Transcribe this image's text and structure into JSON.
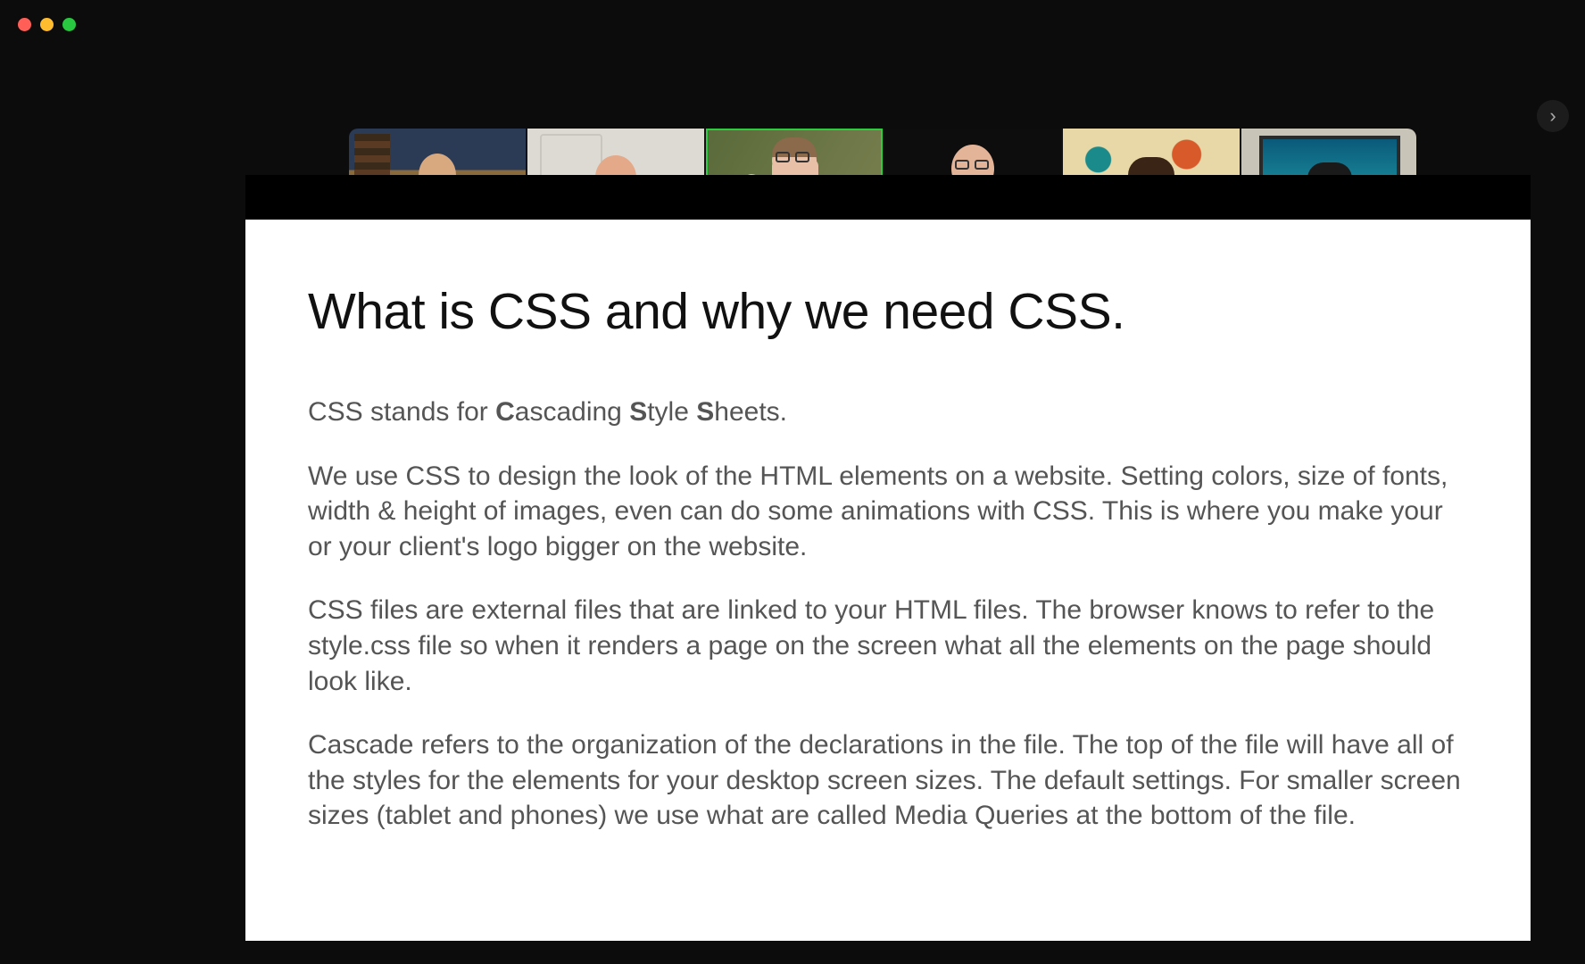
{
  "window": {
    "traffic_lights": [
      "close",
      "minimize",
      "maximize"
    ]
  },
  "participants": {
    "count": 6,
    "active_index": 2,
    "items": [
      {
        "name": "participant-1"
      },
      {
        "name": "participant-2"
      },
      {
        "name": "participant-3"
      },
      {
        "name": "participant-4"
      },
      {
        "name": "participant-5"
      },
      {
        "name": "participant-6"
      }
    ],
    "next_label": "›"
  },
  "slide": {
    "title": "What is CSS and why we need CSS.",
    "paragraphs": [
      {
        "pre": "CSS stands for ",
        "b1": "C",
        "mid1": "ascading ",
        "b2": "S",
        "mid2": "tyle ",
        "b3": "S",
        "post": "heets."
      },
      {
        "text": "We use CSS to design the look of the HTML elements on a website. Setting colors, size of fonts, width & height of images, even can do some animations with CSS. This is where you make your or your client's logo bigger on the website."
      },
      {
        "text": "CSS files are external files that are linked to your HTML files. The browser knows to refer to the style.css file so when it renders a page on the screen what all the elements on the page should look like."
      },
      {
        "text": "Cascade refers to the organization of the declarations in the file. The top of the file will have all of the styles for the elements for your desktop screen sizes. The default settings. For smaller screen sizes (tablet and phones) we use what are called Media Queries at the bottom of the file."
      }
    ]
  }
}
